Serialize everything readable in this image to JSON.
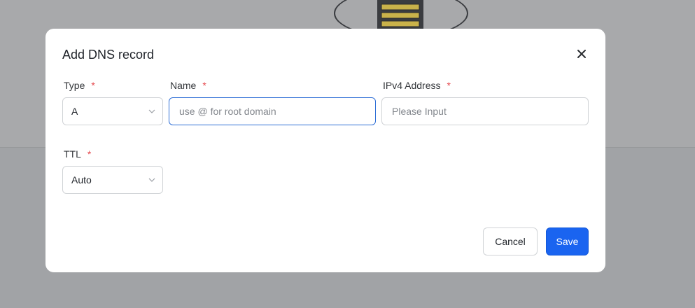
{
  "dialog": {
    "title": "Add DNS record",
    "fields": {
      "type": {
        "label": "Type",
        "required_mark": "*",
        "value": "A"
      },
      "name": {
        "label": "Name",
        "required_mark": "*",
        "placeholder": "use @ for root domain",
        "value": ""
      },
      "ipv4": {
        "label": "IPv4 Address",
        "required_mark": "*",
        "placeholder": "Please Input",
        "value": ""
      },
      "ttl": {
        "label": "TTL",
        "required_mark": "*",
        "value": "Auto"
      }
    },
    "buttons": {
      "cancel": "Cancel",
      "save": "Save"
    }
  },
  "colors": {
    "primary": "#1a64f0",
    "required": "#e5484d",
    "focus_border": "#2f6fd6"
  },
  "icons": {
    "close": "close-icon",
    "select_arrow": "chevron-down-icon"
  }
}
